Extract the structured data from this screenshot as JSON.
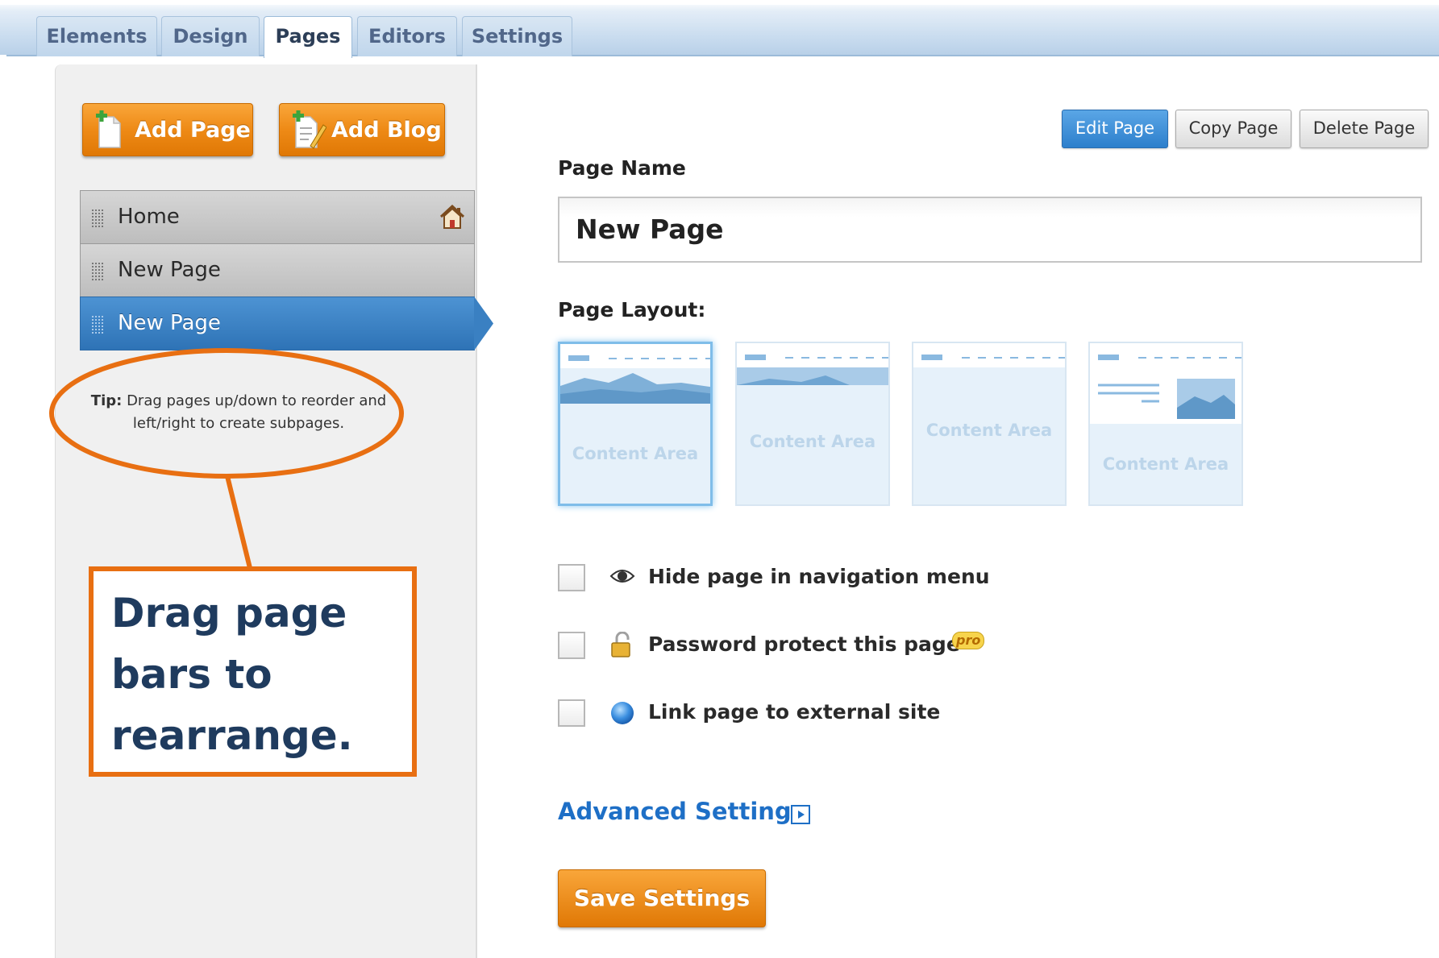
{
  "tabs": [
    {
      "label": "Elements"
    },
    {
      "label": "Design"
    },
    {
      "label": "Pages",
      "active": true
    },
    {
      "label": "Editors"
    },
    {
      "label": "Settings"
    }
  ],
  "sidebar": {
    "add_page": "Add Page",
    "add_blog": "Add Blog",
    "pages": [
      {
        "label": "Home",
        "icon": "home-icon"
      },
      {
        "label": "New Page"
      },
      {
        "label": "New Page",
        "selected": true
      }
    ],
    "tip_prefix": "Tip:",
    "tip_line1": "Drag pages up/down to reorder and",
    "tip_line2": "left/right to create subpages."
  },
  "callout": {
    "line1": "Drag page",
    "line2": "bars to",
    "line3": "rearrange."
  },
  "toolbar": {
    "edit_page": "Edit Page",
    "copy_page": "Copy Page",
    "delete_page": "Delete Page"
  },
  "form": {
    "page_name_label": "Page Name",
    "page_name_value": "New Page",
    "layout_label": "Page Layout:",
    "layouts": [
      {
        "content_label": "Content Area",
        "selected": true
      },
      {
        "content_label": "Content Area"
      },
      {
        "content_label": "Content Area"
      },
      {
        "content_label": "Content Area"
      }
    ],
    "options": [
      {
        "label": "Hide page in navigation menu",
        "icon": "eye-icon",
        "checked": false
      },
      {
        "label": "Password protect this page",
        "icon": "lock-icon",
        "badge": "pro",
        "checked": false
      },
      {
        "label": "Link page to external site",
        "icon": "globe-icon",
        "checked": false
      }
    ],
    "advanced_settings": "Advanced Settings",
    "save_settings": "Save Settings"
  },
  "colors": {
    "accent_orange": "#ee8a16",
    "selected_blue": "#2e73b6",
    "link_blue": "#1e6fc6",
    "callout_text": "#1f3b5e"
  }
}
